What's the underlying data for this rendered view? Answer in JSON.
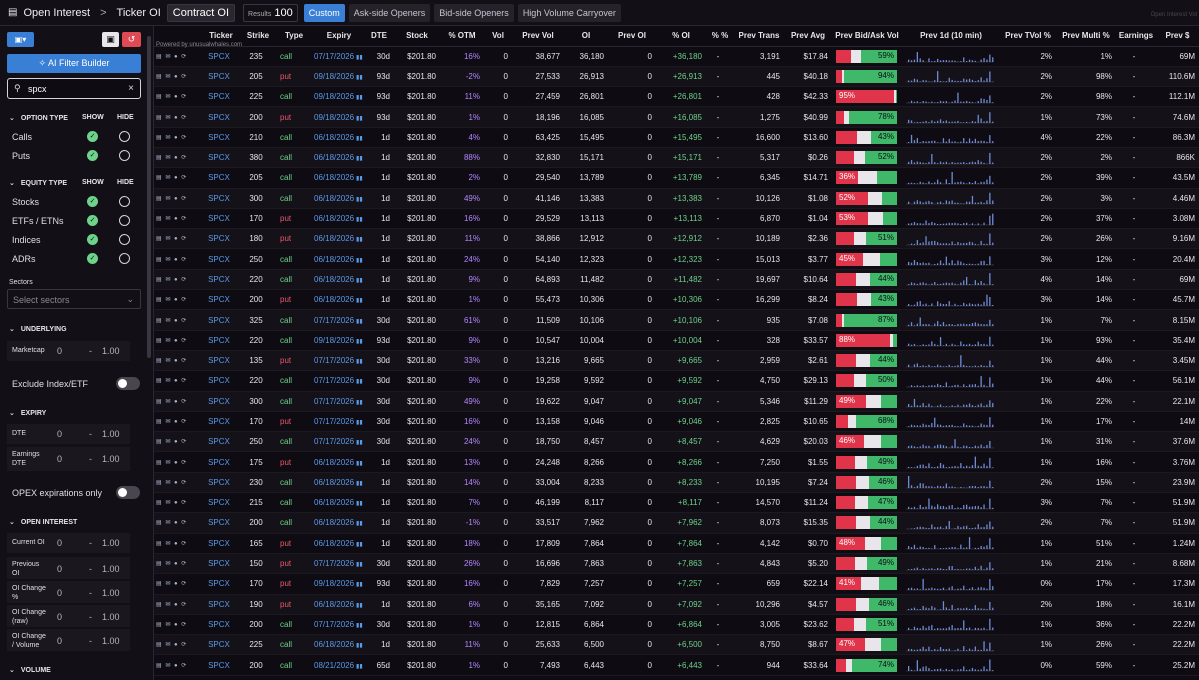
{
  "topbar": {
    "open_interest": "Open Interest",
    "sep": ">",
    "ticker_oi": "Ticker OI",
    "contract_oi": "Contract OI",
    "results_label": "Results",
    "results_value": "100",
    "presets": [
      "Custom",
      "Ask-side Openers",
      "Bid-side Openers",
      "High Volume Carryover"
    ],
    "version_text": "Open Interest Vol"
  },
  "sidebar": {
    "ai_filter": "AI Filter Builder",
    "search_value": "spcx",
    "option_type": {
      "title": "OPTION TYPE",
      "show": "SHOW",
      "hide": "HIDE",
      "items": [
        "Calls",
        "Puts"
      ]
    },
    "equity_type": {
      "title": "EQUITY TYPE",
      "show": "SHOW",
      "hide": "HIDE",
      "items": [
        "Stocks",
        "ETFs / ETNs",
        "Indices",
        "ADRs"
      ]
    },
    "sectors_label": "Sectors",
    "sectors_placeholder": "Select sectors",
    "underlying": {
      "title": "UNDERLYING",
      "marketcap": "Marketcap",
      "lo": "0",
      "dash": "-",
      "hi": "1.00"
    },
    "exclude_label": "Exclude Index/ETF",
    "expiry": {
      "title": "EXPIRY",
      "dte": "DTE",
      "earn1": "Earnings",
      "earn2": "DTE",
      "lo": "0",
      "dash": "-",
      "hi": "1.00"
    },
    "opex_label": "OPEX expirations only",
    "open_interest": {
      "title": "OPEN INTEREST",
      "rows": [
        [
          "Current OI",
          ""
        ],
        [
          "Previous",
          "OI"
        ],
        [
          "OI Change",
          "%"
        ],
        [
          "OI Change",
          "(raw)"
        ],
        [
          "OI Change",
          "/ Volume"
        ]
      ],
      "lo": "0",
      "dash": "-",
      "hi": "1.00"
    },
    "volume_title": "VOLUME"
  },
  "table": {
    "powered": "Powered by unusualwhales.com",
    "columns": [
      "",
      "Ticker",
      "Strike",
      "Type",
      "Expiry",
      "DTE",
      "Stock",
      "% OTM",
      "Vol",
      "Prev Vol",
      "OI",
      "Prev OI",
      "% OI",
      "% %",
      "Prev Trans",
      "Prev Avg",
      "Prev Bid/Ask Vol",
      "Prev 1d (10 min)",
      "Prev TVol %",
      "Prev Multi %",
      "Earnings",
      "Prev $"
    ],
    "icons_text": "▤ ✉ ● ⟳",
    "rows": [
      [
        "SPCX",
        "235",
        "call",
        "07/17/2026",
        "30d",
        "$201.80",
        "16%",
        "0",
        "38,677",
        "36,180",
        "0",
        "+36,180",
        "-",
        "3,191",
        "$17.84",
        "",
        "59%",
        "2%",
        "1%",
        "-",
        "69M"
      ],
      [
        "SPCX",
        "205",
        "put",
        "09/18/2026",
        "93d",
        "$201.80",
        "-2%",
        "0",
        "27,533",
        "26,913",
        "0",
        "+26,913",
        "-",
        "445",
        "$40.18",
        "",
        "94%",
        "2%",
        "98%",
        "-",
        "110.6M"
      ],
      [
        "SPCX",
        "225",
        "call",
        "09/18/2026",
        "93d",
        "$201.80",
        "11%",
        "0",
        "27,459",
        "26,801",
        "0",
        "+26,801",
        "-",
        "428",
        "$42.33",
        "95%",
        "",
        "2%",
        "98%",
        "-",
        "112.1M"
      ],
      [
        "SPCX",
        "200",
        "put",
        "09/18/2026",
        "93d",
        "$201.80",
        "1%",
        "0",
        "18,196",
        "16,085",
        "0",
        "+16,085",
        "-",
        "1,275",
        "$40.99",
        "",
        "78%",
        "1%",
        "73%",
        "-",
        "74.6M"
      ],
      [
        "SPCX",
        "210",
        "call",
        "06/18/2026",
        "1d",
        "$201.80",
        "4%",
        "0",
        "63,425",
        "15,495",
        "0",
        "+15,495",
        "-",
        "16,600",
        "$13.60",
        "",
        "43%",
        "4%",
        "22%",
        "-",
        "86.3M"
      ],
      [
        "SPCX",
        "380",
        "call",
        "06/18/2026",
        "1d",
        "$201.80",
        "88%",
        "0",
        "32,830",
        "15,171",
        "0",
        "+15,171",
        "-",
        "5,317",
        "$0.26",
        "",
        "52%",
        "2%",
        "2%",
        "-",
        "866K"
      ],
      [
        "SPCX",
        "205",
        "call",
        "06/18/2026",
        "1d",
        "$201.80",
        "2%",
        "0",
        "29,540",
        "13,789",
        "0",
        "+13,789",
        "-",
        "6,345",
        "$14.71",
        "36%",
        "",
        "2%",
        "39%",
        "-",
        "43.5M"
      ],
      [
        "SPCX",
        "300",
        "call",
        "06/18/2026",
        "1d",
        "$201.80",
        "49%",
        "0",
        "41,146",
        "13,383",
        "0",
        "+13,383",
        "-",
        "10,126",
        "$1.08",
        "52%",
        "",
        "2%",
        "3%",
        "-",
        "4.46M"
      ],
      [
        "SPCX",
        "170",
        "put",
        "06/18/2026",
        "1d",
        "$201.80",
        "16%",
        "0",
        "29,529",
        "13,113",
        "0",
        "+13,113",
        "-",
        "6,870",
        "$1.04",
        "53%",
        "",
        "2%",
        "37%",
        "-",
        "3.08M"
      ],
      [
        "SPCX",
        "180",
        "put",
        "06/18/2026",
        "1d",
        "$201.80",
        "11%",
        "0",
        "38,866",
        "12,912",
        "0",
        "+12,912",
        "-",
        "10,189",
        "$2.36",
        "",
        "51%",
        "2%",
        "26%",
        "-",
        "9.16M"
      ],
      [
        "SPCX",
        "250",
        "call",
        "06/18/2026",
        "1d",
        "$201.80",
        "24%",
        "0",
        "54,140",
        "12,323",
        "0",
        "+12,323",
        "-",
        "15,013",
        "$3.77",
        "45%",
        "",
        "3%",
        "12%",
        "-",
        "20.4M"
      ],
      [
        "SPCX",
        "220",
        "call",
        "06/18/2026",
        "1d",
        "$201.80",
        "9%",
        "0",
        "64,893",
        "11,482",
        "0",
        "+11,482",
        "-",
        "19,697",
        "$10.64",
        "",
        "44%",
        "4%",
        "14%",
        "-",
        "69M"
      ],
      [
        "SPCX",
        "200",
        "put",
        "06/18/2026",
        "1d",
        "$201.80",
        "1%",
        "0",
        "55,473",
        "10,306",
        "0",
        "+10,306",
        "-",
        "16,299",
        "$8.24",
        "",
        "43%",
        "3%",
        "14%",
        "-",
        "45.7M"
      ],
      [
        "SPCX",
        "325",
        "call",
        "07/17/2026",
        "30d",
        "$201.80",
        "61%",
        "0",
        "11,509",
        "10,106",
        "0",
        "+10,106",
        "-",
        "935",
        "$7.08",
        "",
        "87%",
        "1%",
        "7%",
        "-",
        "8.15M"
      ],
      [
        "SPCX",
        "220",
        "call",
        "09/18/2026",
        "93d",
        "$201.80",
        "9%",
        "0",
        "10,547",
        "10,004",
        "0",
        "+10,004",
        "-",
        "328",
        "$33.57",
        "88%",
        "",
        "1%",
        "93%",
        "-",
        "35.4M"
      ],
      [
        "SPCX",
        "135",
        "put",
        "07/17/2026",
        "30d",
        "$201.80",
        "33%",
        "0",
        "13,216",
        "9,665",
        "0",
        "+9,665",
        "-",
        "2,959",
        "$2.61",
        "",
        "44%",
        "1%",
        "44%",
        "-",
        "3.45M"
      ],
      [
        "SPCX",
        "220",
        "call",
        "07/17/2026",
        "30d",
        "$201.80",
        "9%",
        "0",
        "19,258",
        "9,592",
        "0",
        "+9,592",
        "-",
        "4,750",
        "$29.13",
        "",
        "50%",
        "1%",
        "44%",
        "-",
        "56.1M"
      ],
      [
        "SPCX",
        "300",
        "call",
        "07/17/2026",
        "30d",
        "$201.80",
        "49%",
        "0",
        "19,622",
        "9,047",
        "0",
        "+9,047",
        "-",
        "5,346",
        "$11.29",
        "49%",
        "",
        "1%",
        "22%",
        "-",
        "22.1M"
      ],
      [
        "SPCX",
        "170",
        "put",
        "07/17/2026",
        "30d",
        "$201.80",
        "16%",
        "0",
        "13,158",
        "9,046",
        "0",
        "+9,046",
        "-",
        "2,825",
        "$10.65",
        "",
        "68%",
        "1%",
        "17%",
        "-",
        "14M"
      ],
      [
        "SPCX",
        "250",
        "call",
        "07/17/2026",
        "30d",
        "$201.80",
        "24%",
        "0",
        "18,750",
        "8,457",
        "0",
        "+8,457",
        "-",
        "4,629",
        "$20.03",
        "46%",
        "",
        "1%",
        "31%",
        "-",
        "37.6M"
      ],
      [
        "SPCX",
        "175",
        "put",
        "06/18/2026",
        "1d",
        "$201.80",
        "13%",
        "0",
        "24,248",
        "8,266",
        "0",
        "+8,266",
        "-",
        "7,250",
        "$1.55",
        "",
        "49%",
        "1%",
        "16%",
        "-",
        "3.76M"
      ],
      [
        "SPCX",
        "230",
        "call",
        "06/18/2026",
        "1d",
        "$201.80",
        "14%",
        "0",
        "33,004",
        "8,233",
        "0",
        "+8,233",
        "-",
        "10,195",
        "$7.24",
        "",
        "46%",
        "2%",
        "15%",
        "-",
        "23.9M"
      ],
      [
        "SPCX",
        "215",
        "call",
        "06/18/2026",
        "1d",
        "$201.80",
        "7%",
        "0",
        "46,199",
        "8,117",
        "0",
        "+8,117",
        "-",
        "14,570",
        "$11.24",
        "",
        "47%",
        "3%",
        "7%",
        "-",
        "51.9M"
      ],
      [
        "SPCX",
        "200",
        "call",
        "06/18/2026",
        "1d",
        "$201.80",
        "-1%",
        "0",
        "33,517",
        "7,962",
        "0",
        "+7,962",
        "-",
        "8,073",
        "$15.35",
        "",
        "44%",
        "2%",
        "7%",
        "-",
        "51.9M"
      ],
      [
        "SPCX",
        "165",
        "put",
        "06/18/2026",
        "1d",
        "$201.80",
        "18%",
        "0",
        "17,809",
        "7,864",
        "0",
        "+7,864",
        "-",
        "4,142",
        "$0.70",
        "48%",
        "",
        "1%",
        "51%",
        "-",
        "1.24M"
      ],
      [
        "SPCX",
        "150",
        "put",
        "07/17/2026",
        "30d",
        "$201.80",
        "26%",
        "0",
        "16,696",
        "7,863",
        "0",
        "+7,863",
        "-",
        "4,843",
        "$5.20",
        "",
        "49%",
        "1%",
        "21%",
        "-",
        "8.68M"
      ],
      [
        "SPCX",
        "170",
        "put",
        "09/18/2026",
        "93d",
        "$201.80",
        "16%",
        "0",
        "7,829",
        "7,257",
        "0",
        "+7,257",
        "-",
        "659",
        "$22.14",
        "41%",
        "",
        "0%",
        "17%",
        "-",
        "17.3M"
      ],
      [
        "SPCX",
        "190",
        "put",
        "06/18/2026",
        "1d",
        "$201.80",
        "6%",
        "0",
        "35,165",
        "7,092",
        "0",
        "+7,092",
        "-",
        "10,296",
        "$4.57",
        "",
        "46%",
        "2%",
        "18%",
        "-",
        "16.1M"
      ],
      [
        "SPCX",
        "200",
        "call",
        "07/17/2026",
        "30d",
        "$201.80",
        "1%",
        "0",
        "12,815",
        "6,864",
        "0",
        "+6,864",
        "-",
        "3,005",
        "$23.62",
        "",
        "51%",
        "1%",
        "36%",
        "-",
        "22.2M"
      ],
      [
        "SPCX",
        "225",
        "call",
        "06/18/2026",
        "1d",
        "$201.80",
        "11%",
        "0",
        "25,633",
        "6,500",
        "0",
        "+6,500",
        "-",
        "8,750",
        "$8.67",
        "47%",
        "",
        "1%",
        "26%",
        "-",
        "22.2M"
      ],
      [
        "SPCX",
        "200",
        "call",
        "08/21/2026",
        "65d",
        "$201.80",
        "1%",
        "0",
        "7,493",
        "6,443",
        "0",
        "+6,443",
        "-",
        "944",
        "$33.64",
        "",
        "74%",
        "0%",
        "59%",
        "-",
        "25.2M"
      ]
    ]
  }
}
